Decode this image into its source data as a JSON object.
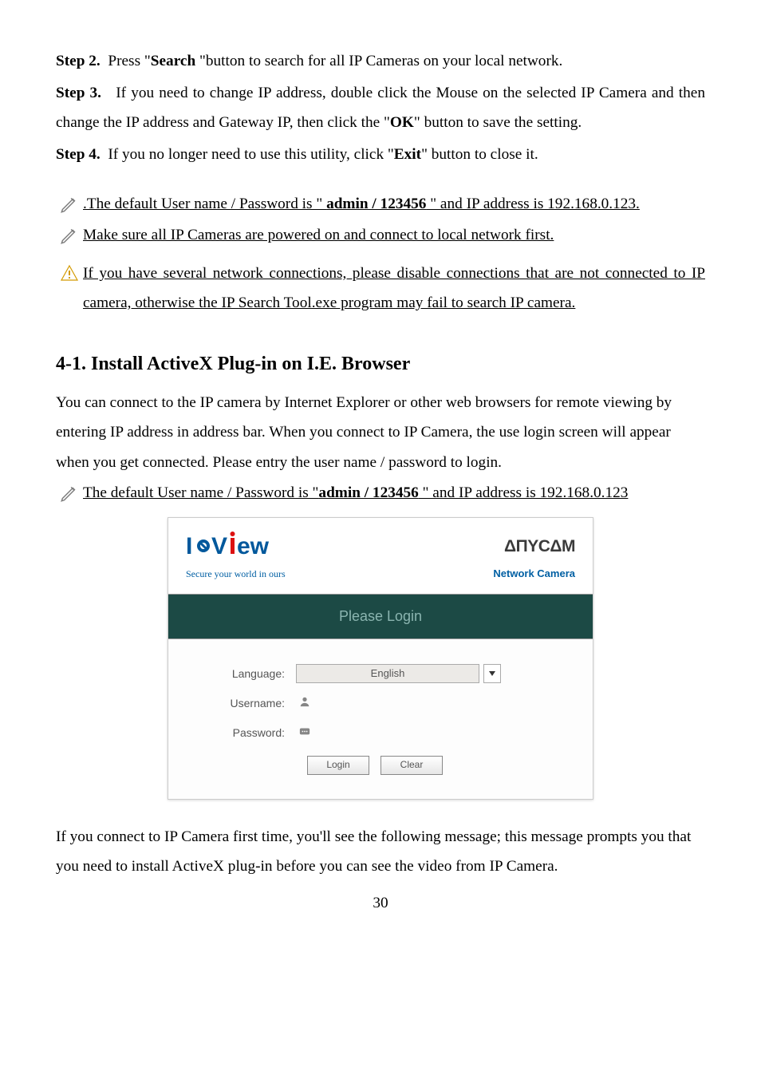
{
  "steps": {
    "s2": {
      "label": "Step 2.",
      "text_a": "Press \"",
      "bold": "Search",
      "text_b": " \"button to search for all IP Cameras on your local network."
    },
    "s3": {
      "label": "Step 3.",
      "text_a": "If you need to change IP address, double click the Mouse on the selected IP Camera and then change the IP address and Gateway IP, then click the \"",
      "bold": "OK",
      "text_b": "\" button to save the setting."
    },
    "s4": {
      "label": "Step 4.",
      "text_a": "If you no longer need to use this utility, click \"",
      "bold": "Exit",
      "text_b": "\" button to close it."
    }
  },
  "notes": {
    "n1": {
      "pre": ".The default User name / Password is \" ",
      "bold": "admin / 123456",
      "post": " \" and IP address is 192.168.0.123."
    },
    "n2": "Make sure all IP Cameras are powered on and connect to local network first.",
    "warn": "If you have several network connections, please disable connections that are not connected to IP camera, otherwise the IP Search Tool.exe program may fail to search IP camera."
  },
  "section": {
    "heading": "4-1.   Install ActiveX Plug-in on I.E. Browser",
    "para": "You can connect to the IP camera by Internet Explorer or other web browsers for remote viewing by entering IP address in address bar.    When you connect to IP Camera, the use login screen will appear when you get connected.    Please entry the user name / password to login.",
    "note": {
      "pre": "The default User name / Password is \"",
      "bold": "admin / 123456",
      "post": " \" and IP address is 192.168.0.123"
    }
  },
  "login": {
    "tagline": "Secure your world in ours",
    "brand": "ΔПΥCΔM",
    "brand_sub": "Network Camera",
    "title": "Please Login",
    "labels": {
      "language": "Language:",
      "username": "Username:",
      "password": "Password:"
    },
    "language_value": "English",
    "buttons": {
      "login": "Login",
      "clear": "Clear"
    }
  },
  "after": "If you connect to IP Camera first time, you'll see the following message; this message prompts you that you need to install ActiveX plug-in before you can see the video from IP Camera.",
  "page_number": "30"
}
